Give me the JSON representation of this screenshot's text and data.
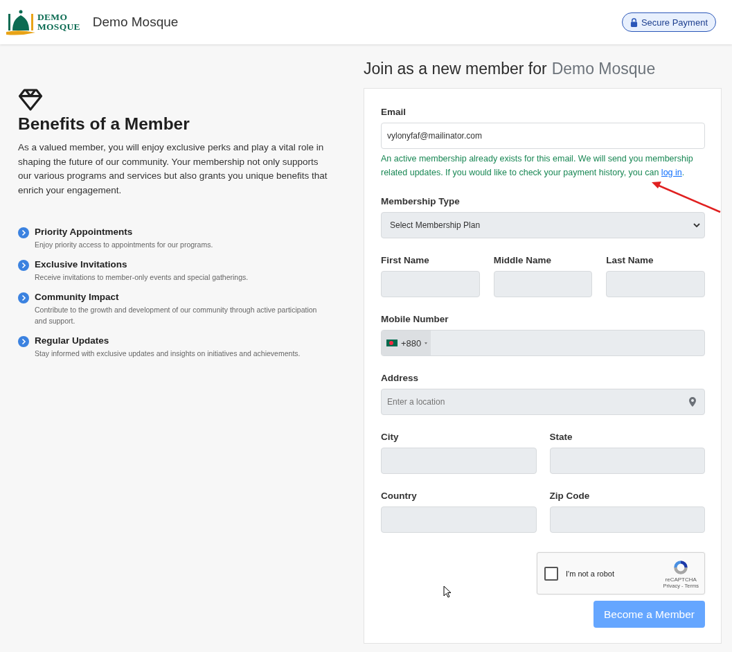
{
  "header": {
    "logo_line1": "DEMO",
    "logo_line2": "MOSQUE",
    "site_name": "Demo Mosque",
    "secure_button": "Secure Payment"
  },
  "benefits": {
    "title": "Benefits of a Member",
    "intro": "As a valued member, you will enjoy exclusive perks and play a vital role in shaping the future of our community. Your membership not only supports our various programs and services but also grants you unique benefits that enrich your engagement.",
    "items": [
      {
        "title": "Priority Appointments",
        "description": "Enjoy priority access to appointments for our programs."
      },
      {
        "title": "Exclusive Invitations",
        "description": "Receive invitations to member-only events and special gatherings."
      },
      {
        "title": "Community Impact",
        "description": "Contribute to the growth and development of our community through active participation and support."
      },
      {
        "title": "Regular Updates",
        "description": "Stay informed with exclusive updates and insights on initiatives and achievements."
      }
    ]
  },
  "form": {
    "title": "Join as a new member for",
    "title_highlight": "Demo Mosque",
    "email": {
      "label": "Email",
      "value": "vylonyfaf@mailinator.com",
      "disabled": false
    },
    "email_notice": {
      "text": "An active membership already exists for this email. We will send you membership related updates. If you would like to check your payment history, you can",
      "link": "log in",
      "end": "."
    },
    "membership_type": {
      "label": "Membership Type",
      "value": "Select Membership Plan",
      "disabled": true
    },
    "name_fields": [
      {
        "label": "First Name",
        "disabled": true
      },
      {
        "label": "Middle Name",
        "disabled": true
      },
      {
        "label": "Last Name",
        "disabled": true
      }
    ],
    "mobile": {
      "label": "Mobile Number",
      "country_code": "+880",
      "disabled": true
    },
    "address": {
      "label": "Address",
      "placeholder": "Enter a location",
      "disabled": true
    },
    "location_fields": [
      {
        "label": "City",
        "disabled": true
      },
      {
        "label": "State",
        "disabled": true
      },
      {
        "label": "Country",
        "disabled": true
      },
      {
        "label": "Zip Code",
        "disabled": true
      }
    ],
    "captcha": {
      "label": "I'm not a robot",
      "brand": "reCAPTCHA",
      "links": "Privacy - Terms",
      "checked": false
    },
    "submit": {
      "label": "Become a Member",
      "disabled": true
    }
  }
}
